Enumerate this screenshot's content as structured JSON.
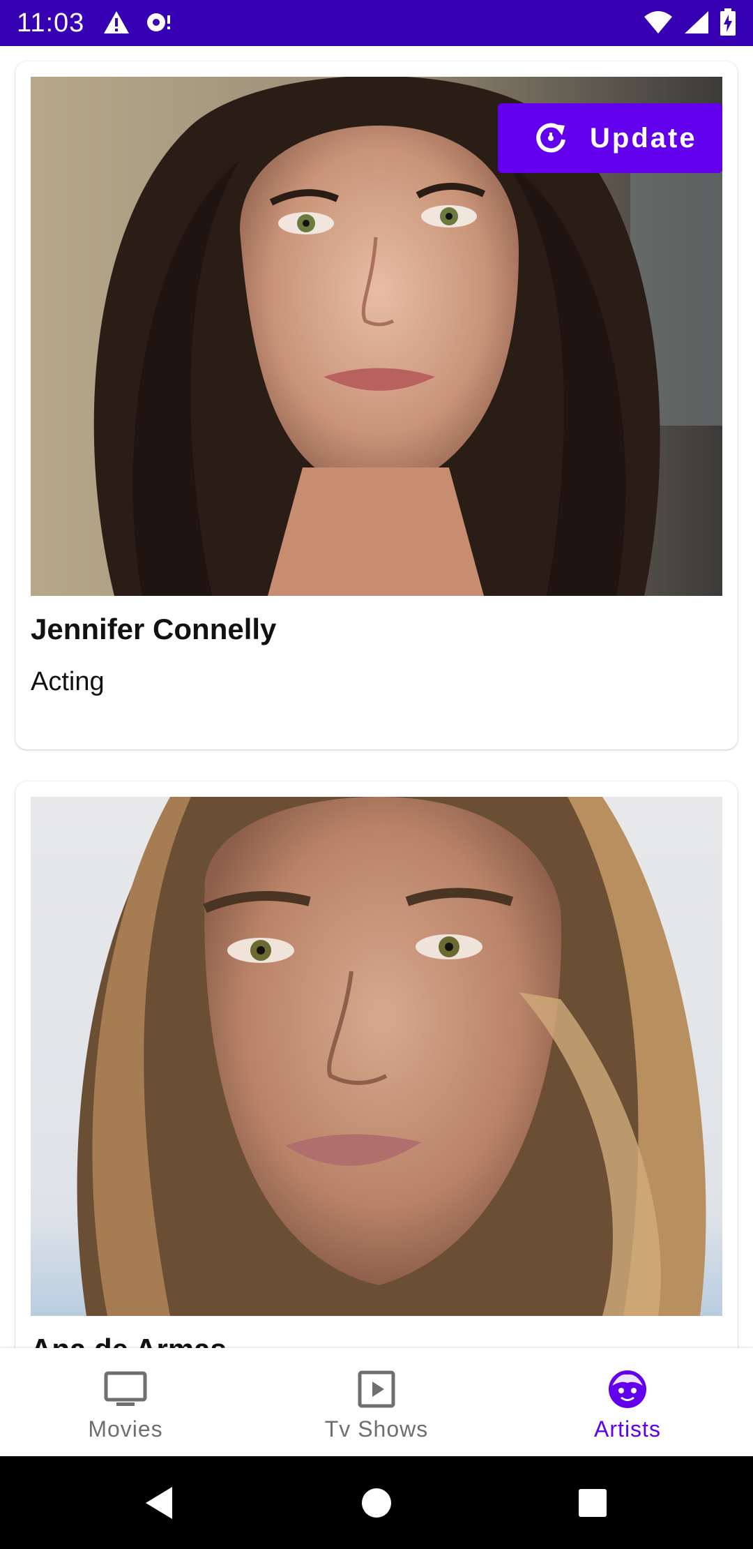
{
  "status_bar": {
    "time": "11:03",
    "left_icons": [
      "alert-icon",
      "sync-notification-icon"
    ],
    "right_icons": [
      "wifi-icon",
      "cellular-signal-icon",
      "battery-charging-icon"
    ]
  },
  "update_button": {
    "label": "Update",
    "icon": "refresh-icon",
    "color": "#6200ee"
  },
  "artists": [
    {
      "name": "Jennifer Connelly",
      "department": "Acting",
      "photo": "artist-photo-jennifer-connelly"
    },
    {
      "name": "Ana de Armas",
      "department": "",
      "photo": "artist-photo-ana-de-armas"
    }
  ],
  "bottom_nav": {
    "items": [
      {
        "label": "Movies",
        "icon": "tv-icon",
        "active": false
      },
      {
        "label": "Tv Shows",
        "icon": "play-box-icon",
        "active": false
      },
      {
        "label": "Artists",
        "icon": "face-icon",
        "active": true
      }
    ],
    "active_color": "#6200ee",
    "inactive_color": "#6f6f6f"
  },
  "system_nav": {
    "buttons": [
      "back-icon",
      "home-icon",
      "recents-icon"
    ]
  },
  "colors": {
    "status_bar": "#3700b3",
    "accent": "#6200ee"
  }
}
